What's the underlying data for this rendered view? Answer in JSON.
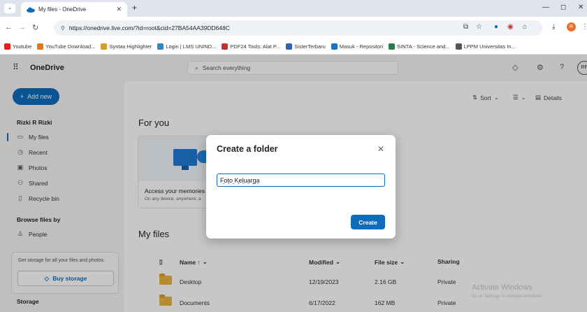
{
  "browser": {
    "tab_title": "My files - OneDrive",
    "url": "https://onedrive.live.com/?id=root&cid=27BA54AA39DD648C",
    "profile_initial": "R",
    "bookmarks": [
      {
        "label": "Youtube",
        "color": "#e62117"
      },
      {
        "label": "YouTube Download...",
        "color": "#e6761a"
      },
      {
        "label": "Syntax Highlighter",
        "color": "#d89c2a"
      },
      {
        "label": "Login | LMS UNIND...",
        "color": "#2f88c8"
      },
      {
        "label": "PDF24 Tools: Alat P...",
        "color": "#c2342c"
      },
      {
        "label": "SisterTerbaru",
        "color": "#2b62c2"
      },
      {
        "label": "Masuk - Repositori",
        "color": "#1a73c2"
      },
      {
        "label": "SINTA - Science and...",
        "color": "#2a7d4a"
      },
      {
        "label": "LPPM Universitas In...",
        "color": "#555555"
      }
    ]
  },
  "app": {
    "brand": "OneDrive",
    "search_placeholder": "Search everything",
    "avatar_initials": "RF"
  },
  "sidebar": {
    "add_new": "Add new",
    "user_name": "Rizki R Rizki",
    "items": [
      {
        "label": "My files"
      },
      {
        "label": "Recent"
      },
      {
        "label": "Photos"
      },
      {
        "label": "Shared"
      },
      {
        "label": "Recycle bin"
      }
    ],
    "browse_title": "Browse files by",
    "people": "People",
    "storage_promo": "Get storage for all your files and photos.",
    "buy_storage": "Buy storage",
    "storage_title": "Storage"
  },
  "main": {
    "sort_label": "Sort",
    "details_label": "Details",
    "for_you": "For you",
    "card_title": "Access your memories",
    "card_subtitle": "On any device, anywhere, a",
    "my_files": "My files",
    "columns": {
      "name": "Name ↑",
      "modified": "Modified",
      "file_size": "File size",
      "sharing": "Sharing"
    },
    "rows": [
      {
        "name": "Desktop",
        "modified": "12/19/2023",
        "size": "2.16 GB",
        "sharing": "Private"
      },
      {
        "name": "Documents",
        "modified": "6/17/2022",
        "size": "162 MB",
        "sharing": "Private"
      }
    ]
  },
  "watermark": {
    "title": "Activate Windows",
    "subtitle": "Go to Settings to activate Windows."
  },
  "dialog": {
    "title": "Create a folder",
    "input_value": "Foto Keluarga",
    "create_label": "Create"
  },
  "colors": {
    "accent": "#0f6cbd"
  }
}
